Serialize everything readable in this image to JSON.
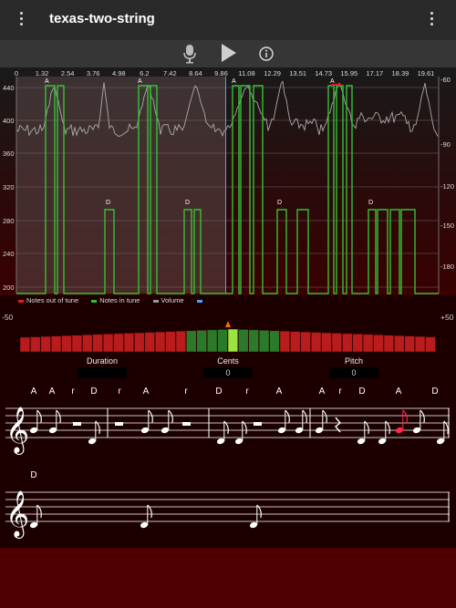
{
  "app": {
    "title": "texas-two-string"
  },
  "toolbar": {
    "mic_icon": "microphone-icon",
    "play_icon": "play-icon",
    "info_icon": "info-icon"
  },
  "chart_data": {
    "type": "line",
    "x_ticks": [
      "0",
      "1.32",
      "2.54",
      "3.76",
      "4.98",
      "6.2",
      "7.42",
      "8.64",
      "9.86",
      "11.08",
      "12.29",
      "13.51",
      "14.73",
      "15.95",
      "17.17",
      "18.39",
      "19.61"
    ],
    "y_left_ticks": [
      "440",
      "400",
      "360",
      "320",
      "280",
      "240",
      "200"
    ],
    "y_right_ticks": [
      "-60",
      "-90",
      "-120",
      "-150",
      "-180"
    ],
    "note_labels": [
      "A",
      "A",
      "D",
      "D",
      "A",
      "A",
      "D",
      "D"
    ],
    "legend": [
      {
        "label": "Notes out of tune",
        "color": "#e02020"
      },
      {
        "label": "Notes in tune",
        "color": "#30c030"
      },
      {
        "label": "Volume",
        "color": "#999999"
      },
      {
        "label": "",
        "color": "#4aa0ff"
      }
    ]
  },
  "meter": {
    "min_label": "-50",
    "max_label": "+50",
    "active_center_index": 14
  },
  "fields": [
    {
      "label": "Duration",
      "value": ""
    },
    {
      "label": "Cents",
      "value": "0"
    },
    {
      "label": "Pitch",
      "value": "0"
    }
  ],
  "score": {
    "line1_letters": [
      "A",
      "A",
      "r",
      "D",
      "r",
      "A",
      "r",
      "D",
      "r",
      "A",
      "A",
      "r",
      "D",
      "A",
      "D"
    ],
    "line2_letters": [
      "D"
    ]
  },
  "colors": {
    "accent": "#30c030",
    "error": "#e02020",
    "background": "#1c0000"
  }
}
